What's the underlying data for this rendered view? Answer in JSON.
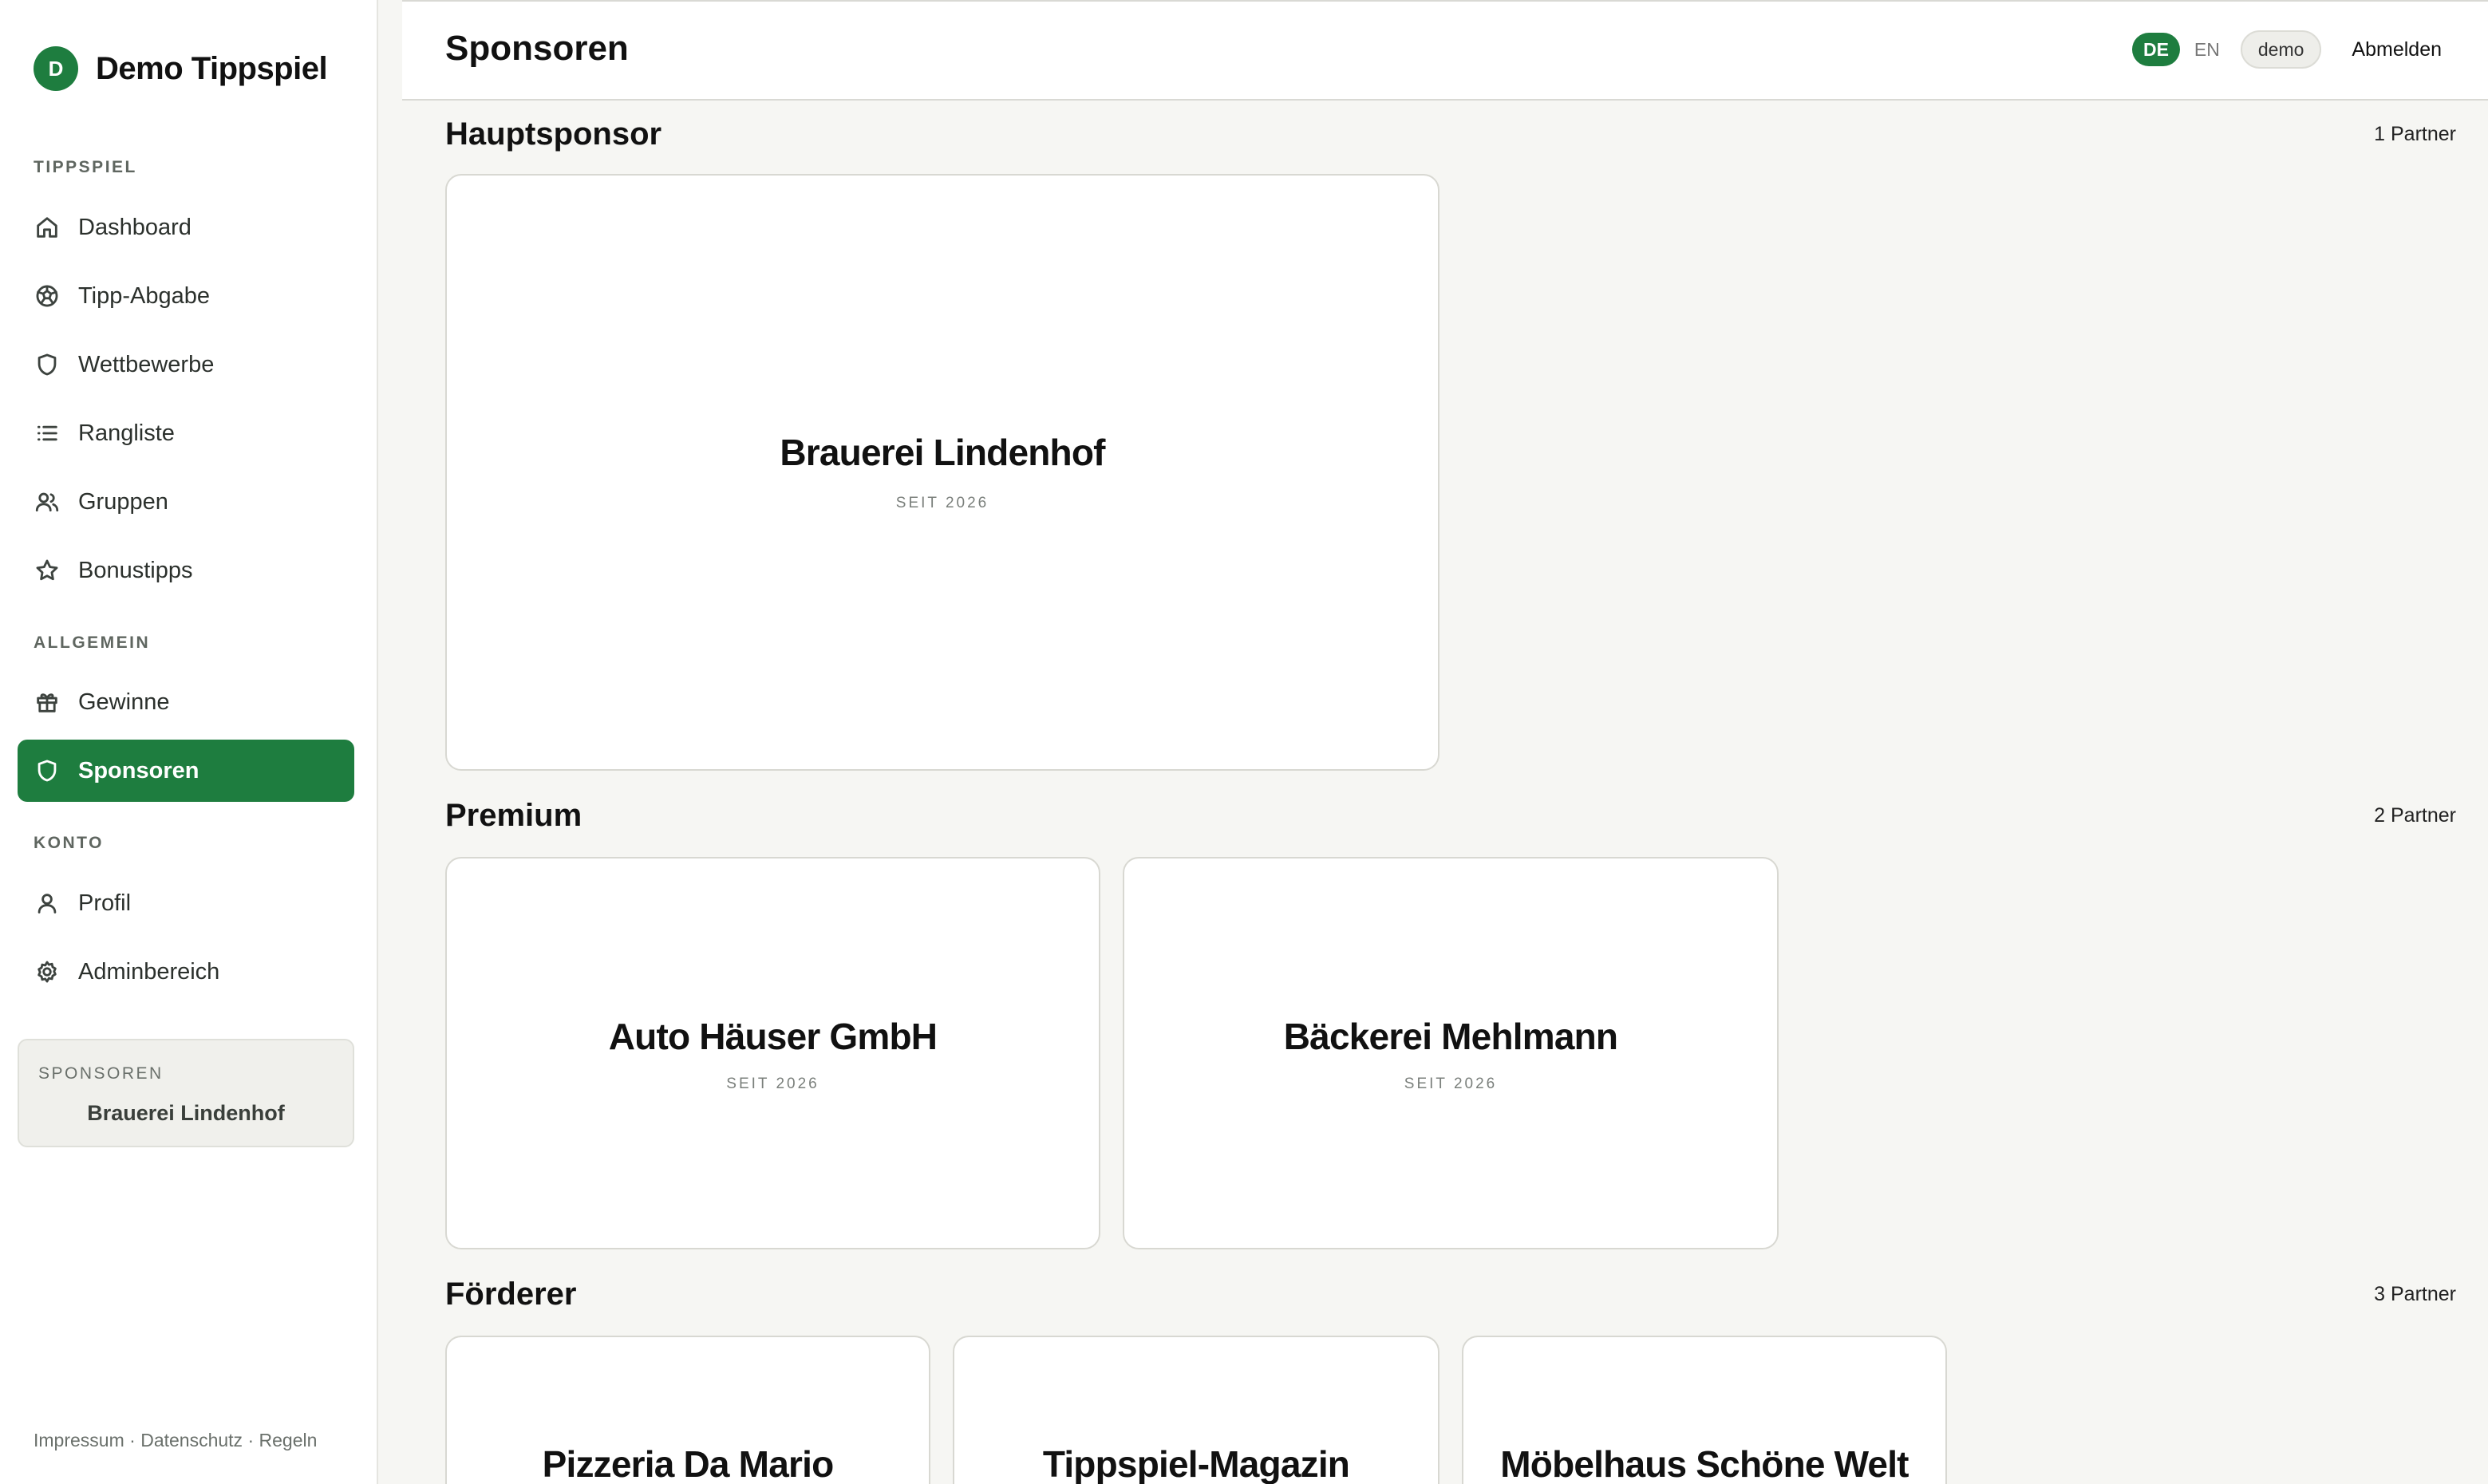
{
  "app": {
    "badge": "D",
    "name": "Demo Tippspiel",
    "accent_color": "#1e7d3f"
  },
  "sidebar": {
    "sections": [
      {
        "label": "TIPPSPIEL",
        "items": [
          {
            "label": "Dashboard",
            "icon": "home-icon"
          },
          {
            "label": "Tipp-Abgabe",
            "icon": "ball-icon"
          },
          {
            "label": "Wettbewerbe",
            "icon": "shield-icon"
          },
          {
            "label": "Rangliste",
            "icon": "list-icon"
          },
          {
            "label": "Gruppen",
            "icon": "users-icon"
          },
          {
            "label": "Bonustipps",
            "icon": "star-icon"
          }
        ]
      },
      {
        "label": "ALLGEMEIN",
        "items": [
          {
            "label": "Gewinne",
            "icon": "gift-icon"
          },
          {
            "label": "Sponsoren",
            "icon": "shield-icon",
            "active": true
          }
        ]
      },
      {
        "label": "KONTO",
        "items": [
          {
            "label": "Profil",
            "icon": "user-icon"
          },
          {
            "label": "Adminbereich",
            "icon": "gear-icon"
          }
        ]
      }
    ],
    "sponsor_box": {
      "label": "SPONSOREN",
      "name": "Brauerei Lindenhof"
    },
    "footer": {
      "impressum": "Impressum",
      "separator": "·",
      "datenschutz": "Datenschutz",
      "regeln": "Regeln"
    }
  },
  "header": {
    "title": "Sponsoren",
    "lang_de": "DE",
    "lang_en": "EN",
    "user": "demo",
    "logout": "Abmelden"
  },
  "tiers": [
    {
      "title": "Hauptsponsor",
      "count": "1 Partner",
      "sponsors": [
        {
          "name": "Brauerei Lindenhof",
          "since": "SEIT 2026"
        }
      ]
    },
    {
      "title": "Premium",
      "count": "2 Partner",
      "sponsors": [
        {
          "name": "Auto Häuser GmbH",
          "since": "SEIT 2026"
        },
        {
          "name": "Bäckerei Mehlmann",
          "since": "SEIT 2026"
        }
      ]
    },
    {
      "title": "Förderer",
      "count": "3 Partner",
      "sponsors": [
        {
          "name": "Pizzeria Da Mario"
        },
        {
          "name": "Tippspiel-Magazin"
        },
        {
          "name": "Möbelhaus Schöne Welt"
        }
      ]
    }
  ]
}
